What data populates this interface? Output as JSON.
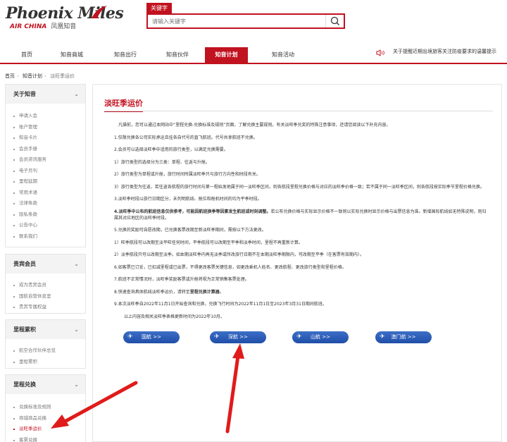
{
  "brand": {
    "logo_text": "Phoenix Miles",
    "airline": "AIR CHINA",
    "cn_name": "凤凰知音",
    "accent_color": "#c1121f"
  },
  "search": {
    "tag": "关键字",
    "placeholder": "请输入关键字",
    "icon": "search-icon"
  },
  "nav": {
    "items": [
      {
        "label": "首页"
      },
      {
        "label": "知音商城"
      },
      {
        "label": "知音出行"
      },
      {
        "label": "知音伙伴"
      },
      {
        "label": "知音计划",
        "active": true
      },
      {
        "label": "知音活动"
      }
    ],
    "notice": "关于提醒近期出境旅客关注防疫要求的温馨提示",
    "notice_icon": "speaker-icon"
  },
  "breadcrumb": [
    "首页",
    "知音计划",
    "淡旺季运价"
  ],
  "sidebar": {
    "groups": [
      {
        "title": "关于知音",
        "items": [
          "申请入会",
          "账户管理",
          "知音卡片",
          "会员手册",
          "会员资讯服务",
          "电子月刊",
          "里程延期",
          "常用术语",
          "法律条款",
          "隐私条款",
          "公告中心",
          "联系我们"
        ]
      },
      {
        "title": "贵宾会员",
        "items": [
          "成为贵宾会员",
          "国航自营休息室",
          "贵宾专属权益"
        ]
      },
      {
        "title": "里程累积",
        "items": [
          "航空合作伙伴总览",
          "里程累积"
        ]
      },
      {
        "title": "里程兑换",
        "items": [
          "兑换标准及规则",
          "商城商品兑换",
          "淡旺季运价",
          "客票兑换"
        ],
        "active_index": 2
      }
    ]
  },
  "main": {
    "title": "淡旺季运价",
    "paragraphs": [
      {
        "text": "凡操前，您可以通过本网站中“里程兑换-兑换标准及规则”页面，了解兑换主要规则。有关淡旺季兑奖的特殊注意事项，还请您阅读以下补充内容。",
        "indent": true
      },
      {
        "text": "1.仅限兑换各公司实际承运且挂各自代号的直飞航班。代号共享航班不兑换。"
      },
      {
        "text": "2.会员可以选择淡旺季中适用的旅行类型，以满足兑换需要。"
      },
      {
        "text": "1）旅行类型的选择分为三类：单程、往返与升舱。"
      },
      {
        "text": "2）旅行类型为单程或升舱，旅行时间所属淡旺季只与旅行方向性和时段有关。"
      },
      {
        "text": "3）旅行类型为往返，若往返各航程的旅行时间与第一程始发地属于同一淡旺季区间，则各航段里程兑换价格与对应的淡旺季价格一致；若不属于同一淡旺季区间，则各航段按实际季节里程价格兑换。"
      },
      {
        "text": "3.淡旺季时段以旅行日期区分，未列明航线、舱位和舱机时间的均为平季时段。"
      },
      {
        "text": "4.淡旺季中公布的航班信息仅供参考，可能因航班换季等因素发生航班或时刻调整。若公布兑换价格与实际显示价格不一致则以实际兑换时显示价格与出票信息为准。新增国际航线如无特殊说明，则归属其对应地区的淡旺季时段。",
        "bold_prefix": "4.淡旺季中公布的航班信息仅供参考，可能因航班换季等因素发生航班或时刻调整。",
        "rest": "若公布兑换价格与实际显示价格不一致则以实际兑换时显示价格与出票信息为准。新增国际航线如无特殊说明，则归属其对应地区的淡旺季时段。"
      },
      {
        "text": "5.兑换的奖励可自愿改期，已兑换客票改期至新淡旺季期间，需按以下方法更改。"
      },
      {
        "text": "1）旺季航段可以改期至淡平旺任何时间，平季航段可以改期至平季和淡季时间，里程不再重新计算。"
      },
      {
        "text": "2）淡季航段只可以改期至淡季。如本期淡旺季内再无淡季或所改旅行日期不在本期淡旺季期限内，可改期至平季（在客票有效期内）。"
      },
      {
        "text": "6.如客票已订妥，已扣减里程或已出票，不得更改客票关键信息，如更改乘机人姓名、更改航程、更改旅行类型和里程价格。"
      },
      {
        "text": "7.航班不正常情况时，淡旺季奖励客票或升舱将视为正常销售客票处理。"
      },
      {
        "text": "8.快速查询具体航线淡旺季运价，请转至里程兑换计算器。",
        "bold_prefix": "8.快速查询具体航线淡旺季运价，请转至",
        "bold_mid": "里程兑换计算器",
        "rest": "。"
      },
      {
        "text": "9.本次淡旺季自2022年11月1日开始查询和兑换，兑换飞行时间为2022年11月1日至2023年3月31日期间航班。"
      },
      {
        "text": "以上内容及相关淡旺季表格更新时间为2022年10月。",
        "indent": true
      }
    ],
    "buttons": [
      {
        "label": "国航 >>"
      },
      {
        "label": "深航 >>"
      },
      {
        "label": "山航 >>"
      },
      {
        "label": "澳门航 >>"
      }
    ]
  }
}
